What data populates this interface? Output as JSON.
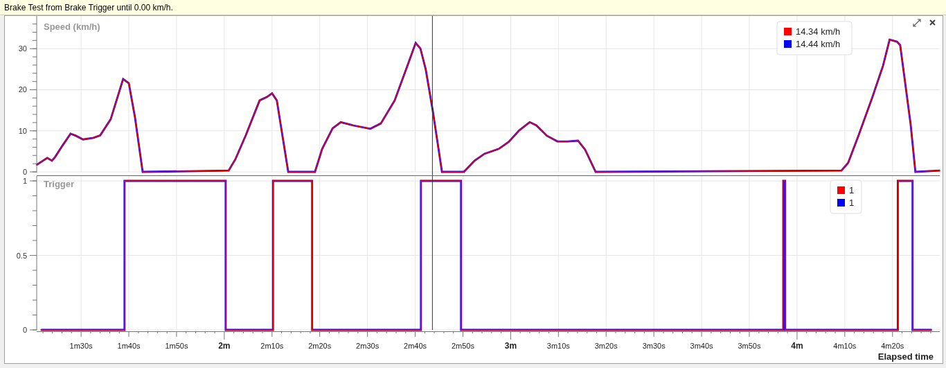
{
  "banner": {
    "text": "Brake Test from Brake Trigger until 0.00 km/h."
  },
  "toolbar": {
    "buttons": [
      {
        "kind": "expand"
      },
      {
        "kind": "close"
      }
    ]
  },
  "charts": [
    {
      "chart_data": {
        "type": "line",
        "title": "Speed (km/h)",
        "grid": true,
        "legend": true,
        "xlim": [
          1.345,
          4.4983
        ],
        "ylim": [
          0,
          37.8
        ],
        "yticks": [
          0,
          10,
          20,
          30
        ],
        "x": [
          1.345,
          1.3817,
          1.3983,
          1.41,
          1.435,
          1.4633,
          1.4817,
          1.5067,
          1.5433,
          1.5667,
          1.6033,
          1.6467,
          1.6667,
          1.6883,
          1.715,
          2.015,
          2.0383,
          2.075,
          2.1233,
          2.1483,
          2.1667,
          2.1833,
          2.2233,
          2.3167,
          2.3417,
          2.3783,
          2.4067,
          2.45,
          2.51,
          2.5467,
          2.595,
          2.6433,
          2.6683,
          2.685,
          2.7033,
          2.7283,
          2.76,
          2.8367,
          2.8733,
          2.9083,
          2.9583,
          2.9933,
          3.03,
          3.0667,
          3.09,
          3.1267,
          3.1633,
          3.1983,
          3.235,
          3.26,
          3.2967,
          4.155,
          4.1783,
          4.215,
          4.2633,
          4.3,
          4.3233,
          4.3483,
          4.36,
          4.3967,
          4.4133,
          4.4983
        ],
        "series": [
          {
            "name": "14.34 km/h",
            "color": "#ff0000",
            "values": [
              1.7,
              3.4,
              2.7,
              3.7,
              6.4,
              9.3,
              8.8,
              7.9,
              8.3,
              8.9,
              12.8,
              22.6,
              21.6,
              13.2,
              0,
              0.3,
              3.0,
              8.9,
              17.4,
              18.2,
              19.1,
              17.4,
              0,
              0,
              5.6,
              10.6,
              12.1,
              11.3,
              10.5,
              11.8,
              17.4,
              26.6,
              31.4,
              30.0,
              25.0,
              14.8,
              0,
              0,
              2.7,
              4.4,
              5.6,
              7.3,
              10.1,
              12.1,
              11.3,
              8.8,
              7.4,
              7.4,
              7.6,
              5.4,
              0,
              0.3,
              2.2,
              8.9,
              18.2,
              25.8,
              32.2,
              31.7,
              30.9,
              11.5,
              0,
              0.3
            ]
          },
          {
            "name": "14.44 km/h",
            "color": "#0000ff",
            "values": [
              1.7,
              3.4,
              2.7,
              3.7,
              6.4,
              9.3,
              8.8,
              7.9,
              8.3,
              8.9,
              12.8,
              22.6,
              21.6,
              13.2,
              0,
              0.3,
              3.0,
              8.9,
              17.4,
              18.2,
              19.1,
              17.4,
              0,
              0,
              5.6,
              10.6,
              12.1,
              11.3,
              10.5,
              11.8,
              17.4,
              26.6,
              31.4,
              30.0,
              25.0,
              14.8,
              0,
              0,
              2.7,
              4.4,
              5.6,
              7.3,
              10.1,
              12.1,
              11.3,
              8.8,
              7.4,
              7.4,
              7.6,
              5.4,
              0,
              0.3,
              2.2,
              8.9,
              18.2,
              25.8,
              32.2,
              31.7,
              30.9,
              11.5,
              0,
              0.3
            ]
          }
        ],
        "ref_lines": [
          {
            "axis": "x",
            "value": 2.7267
          }
        ]
      }
    },
    {
      "chart_data": {
        "type": "line",
        "title": "Trigger",
        "xlabel": "Elapsed time",
        "grid": true,
        "legend": true,
        "xlim": [
          1.345,
          4.4983
        ],
        "ylim": [
          0,
          1.03
        ],
        "yticks": [
          0,
          0.5,
          1
        ],
        "xticks": [
          {
            "value": 1.5,
            "label": "1m30s"
          },
          {
            "value": 1.6667,
            "label": "1m40s"
          },
          {
            "value": 1.8333,
            "label": "1m50s"
          },
          {
            "value": 2,
            "label": "2m"
          },
          {
            "value": 2.1667,
            "label": "2m10s"
          },
          {
            "value": 2.3333,
            "label": "2m20s"
          },
          {
            "value": 2.5,
            "label": "2m30s"
          },
          {
            "value": 2.6667,
            "label": "2m40s"
          },
          {
            "value": 2.8333,
            "label": "2m50s"
          },
          {
            "value": 3,
            "label": "3m"
          },
          {
            "value": 3.1667,
            "label": "3m10s"
          },
          {
            "value": 3.3333,
            "label": "3m20s"
          },
          {
            "value": 3.5,
            "label": "3m30s"
          },
          {
            "value": 3.6667,
            "label": "3m40s"
          },
          {
            "value": 3.8333,
            "label": "3m50s"
          },
          {
            "value": 4,
            "label": "4m"
          },
          {
            "value": 4.1667,
            "label": "4m10s"
          },
          {
            "value": 4.3333,
            "label": "4m20s"
          }
        ],
        "x": [
          1.36,
          1.6517,
          1.6517,
          2.005,
          2.005,
          2.17,
          2.17,
          2.3067,
          2.3067,
          2.6867,
          2.6867,
          2.8267,
          2.8267,
          3.9517,
          3.9517,
          3.9583,
          3.9583,
          4.3517,
          4.3517,
          4.4033,
          4.4033,
          4.47
        ],
        "series": [
          {
            "name": "1",
            "color": "#ff0000",
            "values": [
              0,
              0,
              1,
              1,
              0,
              0,
              1,
              1,
              0,
              0,
              1,
              1,
              0,
              0,
              1,
              1,
              0,
              0,
              1,
              1,
              0,
              0
            ]
          },
          {
            "name": "1",
            "color": "#0000ff",
            "values": [
              0,
              0,
              1,
              1,
              0,
              0,
              1,
              1,
              0,
              0,
              1,
              1,
              0,
              0,
              1,
              1,
              0,
              0,
              1,
              1,
              0,
              0
            ]
          }
        ],
        "ref_lines": [
          {
            "axis": "x",
            "value": 2.7267
          }
        ]
      }
    }
  ]
}
